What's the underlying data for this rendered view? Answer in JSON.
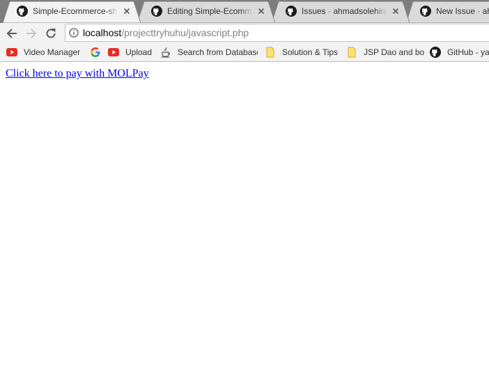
{
  "tabs": [
    {
      "title": "Simple-Ecommerce-shop",
      "icon": "github-icon"
    },
    {
      "title": "Editing Simple-Ecommerce",
      "icon": "github-icon"
    },
    {
      "title": "Issues · ahmadsolehin/Si",
      "icon": "github-icon"
    },
    {
      "title": "New Issue · ahmadsolehin",
      "icon": "github-icon"
    }
  ],
  "toolbar": {
    "url_host": "localhost",
    "url_path": "/projecttryhuhu/javascript.php"
  },
  "bookmarks": [
    {
      "label": "Video Manager",
      "icon": "youtube-icon"
    },
    {
      "label": "",
      "icon": "google-icon"
    },
    {
      "label": "Upload",
      "icon": "youtube-icon"
    },
    {
      "label": "Search from Database",
      "icon": "java-icon"
    },
    {
      "label": "Solution & Tips",
      "icon": "folder-icon"
    },
    {
      "label": "JSP Dao and bo",
      "icon": "folder-icon"
    },
    {
      "label": "GitHub - ya",
      "icon": "github-icon"
    }
  ],
  "page": {
    "link_text": "Click here to pay with MOLPay"
  },
  "colors": {
    "tabstrip": "#7d7d7d",
    "active_tab": "#f2f2f2",
    "inactive_tab": "#dadada",
    "link": "#0000ee"
  }
}
